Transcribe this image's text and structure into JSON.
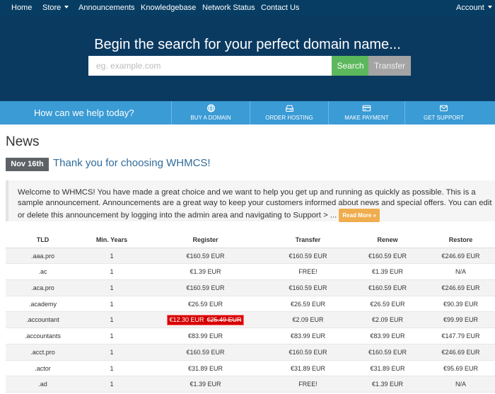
{
  "nav": {
    "items": [
      "Home",
      "Store",
      "Announcements",
      "Knowledgebase",
      "Network Status",
      "Contact Us"
    ],
    "account": "Account"
  },
  "hero": {
    "title": "Begin the search for your perfect domain name...",
    "placeholder": "eg. example.com",
    "search_label": "Search",
    "transfer_label": "Transfer"
  },
  "help": {
    "text": "How can we help today?",
    "actions": [
      {
        "label": "BUY A DOMAIN",
        "icon": "globe-icon"
      },
      {
        "label": "ORDER HOSTING",
        "icon": "hdd-icon"
      },
      {
        "label": "MAKE PAYMENT",
        "icon": "credit-card-icon"
      },
      {
        "label": "GET SUPPORT",
        "icon": "envelope-icon"
      }
    ]
  },
  "news": {
    "heading": "News",
    "date": "Nov 16th",
    "title": "Thank you for choosing WHMCS!",
    "body": "Welcome to WHMCS! You have made a great choice and we want to help you get up and running as quickly as possible. This is a sample announcement. Announcements are a great way to keep your customers informed about news and special offers. You can edit or delete this announcement by logging into the admin area and navigating to Support > ...",
    "read_more": "Read More »"
  },
  "pricing": {
    "headers": [
      "TLD",
      "Min. Years",
      "Register",
      "Transfer",
      "Renew",
      "Restore"
    ],
    "rows": [
      {
        "tld": ".aaa.pro",
        "years": "1",
        "register": "€160.59 EUR",
        "transfer": "€160.59 EUR",
        "renew": "€160.59 EUR",
        "restore": "€246.69 EUR"
      },
      {
        "tld": ".ac",
        "years": "1",
        "register": "€1.39 EUR",
        "transfer": "FREE!",
        "renew": "€1.39 EUR",
        "restore": "N/A"
      },
      {
        "tld": ".aca.pro",
        "years": "1",
        "register": "€160.59 EUR",
        "transfer": "€160.59 EUR",
        "renew": "€160.59 EUR",
        "restore": "€246.69 EUR"
      },
      {
        "tld": ".academy",
        "years": "1",
        "register": "€26.59 EUR",
        "transfer": "€26.59 EUR",
        "renew": "€26.59 EUR",
        "restore": "€90.39 EUR"
      },
      {
        "tld": ".accountant",
        "years": "1",
        "register": "€12.30 EUR",
        "register_old": "€25.49 EUR",
        "transfer": "€2.09 EUR",
        "renew": "€2.09 EUR",
        "restore": "€99.99 EUR"
      },
      {
        "tld": ".accountants",
        "years": "1",
        "register": "€83.99 EUR",
        "transfer": "€83.99 EUR",
        "renew": "€83.99 EUR",
        "restore": "€147.79 EUR"
      },
      {
        "tld": ".acct.pro",
        "years": "1",
        "register": "€160.59 EUR",
        "transfer": "€160.59 EUR",
        "renew": "€160.59 EUR",
        "restore": "€246.69 EUR"
      },
      {
        "tld": ".actor",
        "years": "1",
        "register": "€31.89 EUR",
        "transfer": "€31.89 EUR",
        "renew": "€31.89 EUR",
        "restore": "€95.69 EUR"
      },
      {
        "tld": ".ad",
        "years": "1",
        "register": "€1.39 EUR",
        "transfer": "FREE!",
        "renew": "€1.39 EUR",
        "restore": "N/A"
      }
    ]
  },
  "colors": {
    "nav_bg": "#073d63",
    "hero_bg": "#0b3a61",
    "help_bg": "#3a9bd5",
    "search_btn": "#5cb85c",
    "transfer_btn": "#a4a4a4",
    "read_more": "#f0ad4e",
    "sale": "#d60000",
    "link": "#2f6b9a"
  }
}
